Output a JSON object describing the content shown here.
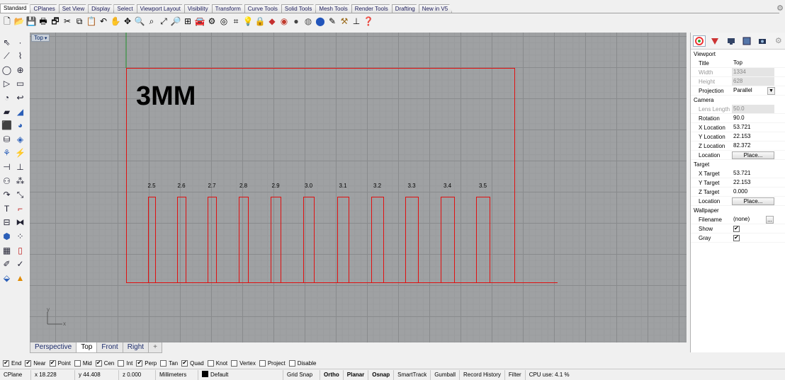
{
  "menu_tabs": [
    "Standard",
    "CPlanes",
    "Set View",
    "Display",
    "Select",
    "Viewport Layout",
    "Visibility",
    "Transform",
    "Curve Tools",
    "Solid Tools",
    "Mesh Tools",
    "Render Tools",
    "Drafting",
    "New in V5"
  ],
  "active_menu_tab": "Standard",
  "toolbar_icons": [
    "new-file-icon",
    "open-file-icon",
    "save-icon",
    "print-icon",
    "import-icon",
    "cut-icon",
    "copy-icon",
    "paste-icon",
    "undo-icon",
    "pan-icon",
    "move-view-icon",
    "zoom-icon",
    "zoom-window-icon",
    "zoom-extents-icon",
    "zoom-selected-icon",
    "four-views-icon",
    "car-icon",
    "options-icon",
    "osnap-icon",
    "grid-icon",
    "light-icon",
    "lock-icon",
    "material-icon",
    "render-icon",
    "shaded-icon",
    "rendered-icon",
    "sphere-icon",
    "clip-icon",
    "tool-icon",
    "dimension-icon",
    "help-icon"
  ],
  "viewport": {
    "label": "Top",
    "text_3mm": "3MM",
    "slot_labels": [
      "2.5",
      "2.6",
      "2.7",
      "2.8",
      "2.9",
      "3.0",
      "3.1",
      "3.2",
      "3.3",
      "3.4",
      "3.5"
    ],
    "axis_y": "y",
    "axis_x": "x",
    "colors": {
      "grid_bg": "#9fa1a3",
      "curve": "#e01010",
      "y_axis": "#1f8f2a"
    }
  },
  "view_tabs": [
    "Perspective",
    "Top",
    "Front",
    "Right",
    "+"
  ],
  "active_view_tab": "Top",
  "properties": {
    "tab_icons": [
      "color-wheel-icon",
      "material-icon",
      "display-icon",
      "image-icon",
      "camera-icon"
    ],
    "viewport_section": "Viewport",
    "title_label": "Title",
    "title_value": "Top",
    "width_label": "Width",
    "width_value": "1334",
    "height_label": "Height",
    "height_value": "628",
    "projection_label": "Projection",
    "projection_value": "Parallel",
    "camera_section": "Camera",
    "lens_label": "Lens Length",
    "lens_value": "50.0",
    "rotation_label": "Rotation",
    "rotation_value": "90.0",
    "xloc_label": "X Location",
    "xloc_value": "53.721",
    "yloc_label": "Y Location",
    "yloc_value": "22.153",
    "zloc_label": "Z Location",
    "zloc_value": "82.372",
    "location_label": "Location",
    "place_button": "Place...",
    "target_section": "Target",
    "xtarget_label": "X Target",
    "xtarget_value": "53.721",
    "ytarget_label": "Y Target",
    "ytarget_value": "22.153",
    "ztarget_label": "Z Target",
    "ztarget_value": "0.000",
    "tlocation_label": "Location",
    "tplace_button": "Place...",
    "wallpaper_section": "Wallpaper",
    "filename_label": "Filename",
    "filename_value": "(none)",
    "browse_button": "...",
    "show_label": "Show",
    "show_checked": true,
    "gray_label": "Gray",
    "gray_checked": true
  },
  "osnaps": [
    {
      "label": "End",
      "checked": true
    },
    {
      "label": "Near",
      "checked": true
    },
    {
      "label": "Point",
      "checked": true
    },
    {
      "label": "Mid",
      "checked": false
    },
    {
      "label": "Cen",
      "checked": true
    },
    {
      "label": "Int",
      "checked": false
    },
    {
      "label": "Perp",
      "checked": true
    },
    {
      "label": "Tan",
      "checked": false
    },
    {
      "label": "Quad",
      "checked": true
    },
    {
      "label": "Knot",
      "checked": false
    },
    {
      "label": "Vertex",
      "checked": false
    },
    {
      "label": "Project",
      "checked": false
    },
    {
      "label": "Disable",
      "checked": false
    }
  ],
  "status": {
    "cplane": "CPlane",
    "x": "x 18.228",
    "y": "y 44.408",
    "z": "z 0.000",
    "units": "Millimeters",
    "layer": "Default",
    "grid_snap": "Grid Snap",
    "ortho": "Ortho",
    "planar": "Planar",
    "osnap": "Osnap",
    "smarttrack": "SmartTrack",
    "gumball": "Gumball",
    "record_history": "Record History",
    "filter": "Filter",
    "cpu": "CPU use: 4.1 %"
  }
}
